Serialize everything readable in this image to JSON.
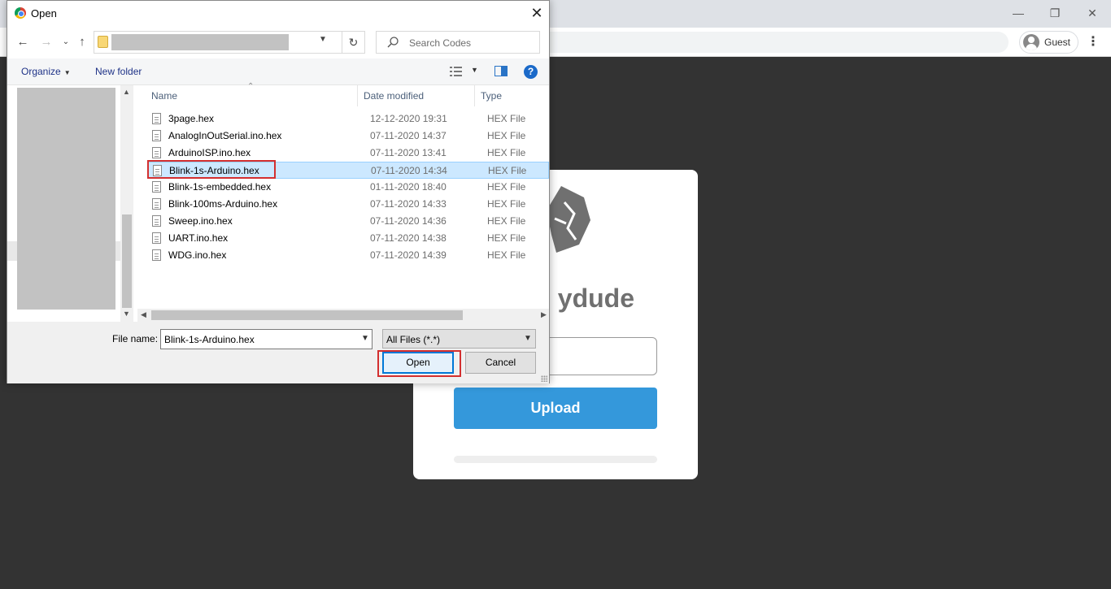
{
  "browser": {
    "profile_label": "Guest"
  },
  "page": {
    "brand_text": "ydude",
    "upload_label": "Upload"
  },
  "dialog": {
    "title": "Open",
    "search_placeholder": "Search Codes",
    "commands": {
      "organize": "Organize",
      "new_folder": "New folder"
    },
    "columns": {
      "name": "Name",
      "date": "Date modified",
      "type": "Type"
    },
    "files": [
      {
        "name": "3page.hex",
        "date": "12-12-2020 19:31",
        "type": "HEX File"
      },
      {
        "name": "AnalogInOutSerial.ino.hex",
        "date": "07-11-2020 14:37",
        "type": "HEX File"
      },
      {
        "name": "ArduinoISP.ino.hex",
        "date": "07-11-2020 13:41",
        "type": "HEX File"
      },
      {
        "name": "Blink-1s-Arduino.hex",
        "date": "07-11-2020 14:34",
        "type": "HEX File"
      },
      {
        "name": "Blink-1s-embedded.hex",
        "date": "01-11-2020 18:40",
        "type": "HEX File"
      },
      {
        "name": "Blink-100ms-Arduino.hex",
        "date": "07-11-2020 14:33",
        "type": "HEX File"
      },
      {
        "name": "Sweep.ino.hex",
        "date": "07-11-2020 14:36",
        "type": "HEX File"
      },
      {
        "name": "UART.ino.hex",
        "date": "07-11-2020 14:38",
        "type": "HEX File"
      },
      {
        "name": "WDG.ino.hex",
        "date": "07-11-2020 14:39",
        "type": "HEX File"
      }
    ],
    "selected_index": 3,
    "file_name_label": "File name:",
    "file_name_value": "Blink-1s-Arduino.hex",
    "file_type_filter": "All Files (*.*)",
    "open_label": "Open",
    "cancel_label": "Cancel"
  },
  "colors": {
    "accent_upload": "#3498db",
    "selection": "#cce8ff",
    "highlight_red": "#d32f2f"
  }
}
